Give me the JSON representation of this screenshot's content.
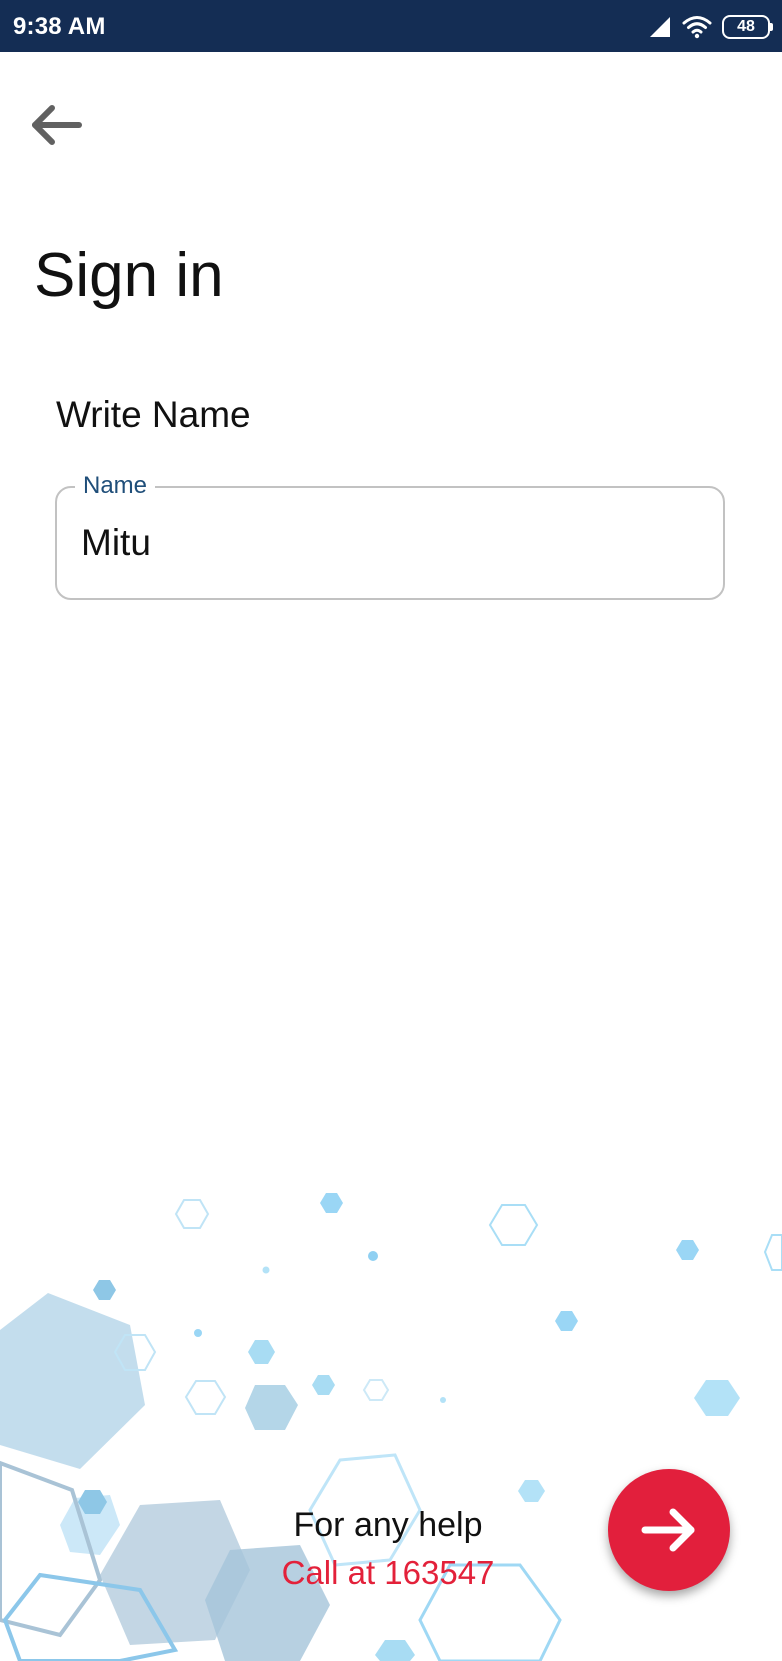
{
  "status_bar": {
    "time": "9:38 AM",
    "battery": "48",
    "background_color": "#142d54"
  },
  "header": {
    "back_icon": "arrow-left-icon",
    "title": "Sign in"
  },
  "form": {
    "heading": "Write Name",
    "name_field": {
      "label": "Name",
      "value": "Mitu"
    }
  },
  "footer": {
    "help_text": "For any help",
    "call_text": "Call at 163547",
    "next_icon": "arrow-right-icon"
  },
  "colors": {
    "accent": "#e21f3c",
    "label": "#1f4e79",
    "field_border": "#c2c2c2"
  }
}
